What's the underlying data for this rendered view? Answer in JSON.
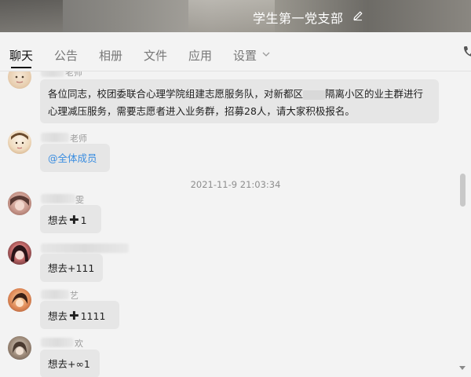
{
  "header": {
    "title": "学生第一党支部",
    "edit_icon": "pencil-icon"
  },
  "tabs": [
    {
      "label": "聊天",
      "active": true
    },
    {
      "label": "公告",
      "active": false
    },
    {
      "label": "相册",
      "active": false
    },
    {
      "label": "文件",
      "active": false
    },
    {
      "label": "应用",
      "active": false
    },
    {
      "label": "设置",
      "active": false
    }
  ],
  "toolbar": {
    "settings_dropdown_icon": "chevron-down-icon",
    "call_icon": "phone-icon"
  },
  "messages": [
    {
      "sender_suffix": "老师",
      "text_line1_a": "各位同志，校团委联合心理学院组建志愿服务队，对新都区",
      "text_line1_b": "隔离小区的业主群进行",
      "text_line2": "心理减压服务，需要志愿者进入业务群，招募28人，请大家积极报名。"
    },
    {
      "sender_suffix": "老师",
      "text": "@全体成员"
    },
    {
      "timestamp": "2021-11-9 21:03:34"
    },
    {
      "sender_suffix": "雯",
      "text_a": "想去",
      "text_b": "1"
    },
    {
      "sender_suffix": "",
      "text": "想去+111"
    },
    {
      "sender_suffix": "艺",
      "text_a": "想去",
      "text_b": "1111"
    },
    {
      "sender_suffix": "欢",
      "text": "想去+∞1"
    }
  ],
  "colors": {
    "accent_link": "#3a8de0",
    "bubble": "#e6e6e6",
    "background": "#f3f3f3"
  }
}
